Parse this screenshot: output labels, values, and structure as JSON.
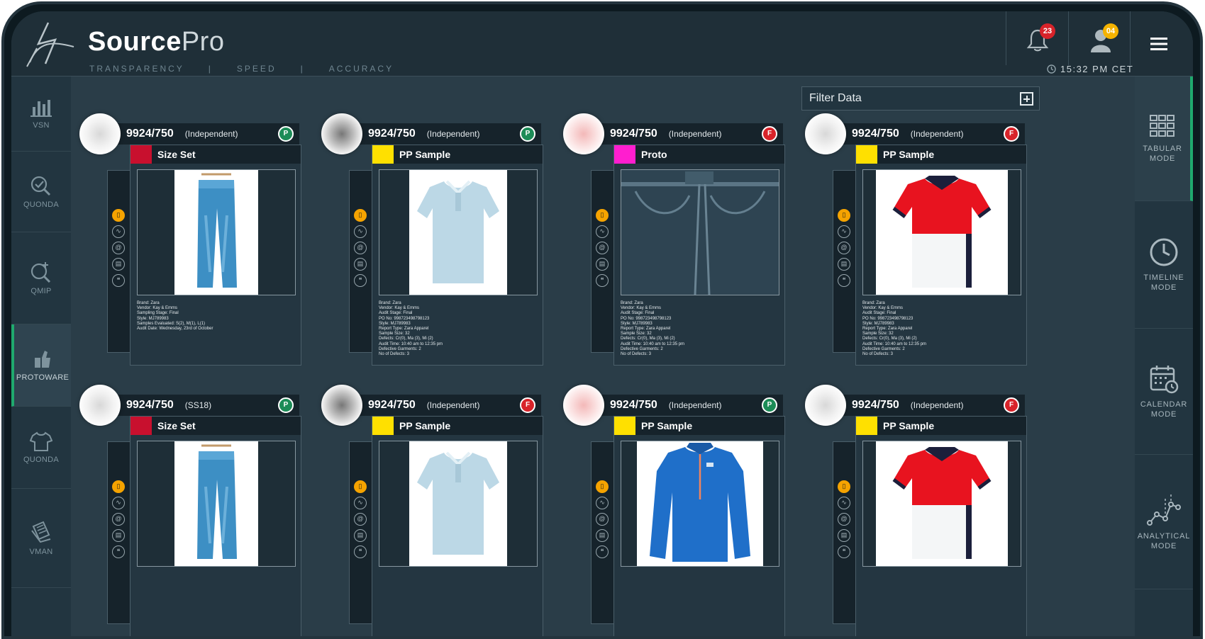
{
  "header": {
    "brand_bold": "Source",
    "brand_light": "Pro",
    "tag1": "TRANSPARENCY",
    "tag2": "SPEED",
    "tag3": "ACCURACY",
    "tag_sep": "|",
    "notifications_count": "23",
    "user_count": "04",
    "time": "15:32 PM CET"
  },
  "left_nav": [
    {
      "label": "VSN",
      "icon": "bar-chart-icon"
    },
    {
      "label": "QUONDA",
      "icon": "search-check-icon"
    },
    {
      "label": "QMIP",
      "icon": "search-plus-icon"
    },
    {
      "label": "PROTOWARE",
      "icon": "hand-icon"
    },
    {
      "label": "QUONDA",
      "icon": "tshirt-icon"
    },
    {
      "label": "VMAN",
      "icon": "document-icon"
    }
  ],
  "right_nav": [
    {
      "line1": "TABULAR",
      "line2": "MODE",
      "icon": "grid-icon"
    },
    {
      "line1": "TIMELINE",
      "line2": "MODE",
      "icon": "clock-icon"
    },
    {
      "line1": "CALENDAR",
      "line2": "MODE",
      "icon": "calendar-icon"
    },
    {
      "line1": "ANALYTICAL",
      "line2": "MODE",
      "icon": "graph-icon"
    }
  ],
  "filter": {
    "label": "Filter Data"
  },
  "colors": {
    "pass": "#1c8c57",
    "fail": "#d8232a",
    "red": "#c8102e",
    "yellow": "#ffe000",
    "magenta": "#ff1ecf"
  },
  "cards": [
    {
      "code": "9924/750",
      "season": "(Independent)",
      "status": "P",
      "sample": "Size Set",
      "swatch": "#c8102e",
      "details": [
        "Brand: Zara",
        "Vendor: Kay & Emms",
        "Sampling Stage: Final",
        "Style: MJ789983",
        "Samples Evaluated: S(2), M(1), L(1)",
        "Audit Date: Wednesday, 23rd of October"
      ]
    },
    {
      "code": "9924/750",
      "season": "(Independent)",
      "status": "P",
      "sample": "PP Sample",
      "swatch": "#ffe000",
      "details": [
        "Brand: Zara",
        "Vendor: Kay & Emms",
        "Audit Stage: Final",
        "PO No: 998723498798123",
        "Style: MJ789983",
        "Report Type: Zara Apparel",
        "Sample Size: 32",
        "Defects: Cr(0), Ma (3), Mi (2)",
        "Audit Time: 10:40 am to 12:35 pm",
        "Defective Garments: 2",
        "No of Defects: 3"
      ]
    },
    {
      "code": "9924/750",
      "season": "(Independent)",
      "status": "F",
      "sample": "Proto",
      "swatch": "#ff1ecf",
      "details": [
        "Brand: Zara",
        "Vendor: Kay & Emms",
        "Audit Stage: Final",
        "PO No: 998723498798123",
        "Style: MJ789983",
        "Report Type: Zara Apparel",
        "Sample Size: 32",
        "Defects: Cr(0), Ma (3), Mi (2)",
        "Audit Time: 10:40 am to 12:35 pm",
        "Defective Garments: 2",
        "No of Defects: 3"
      ]
    },
    {
      "code": "9924/750",
      "season": "(Independent)",
      "status": "F",
      "sample": "PP Sample",
      "swatch": "#ffe000",
      "details": [
        "Brand: Zara",
        "Vendor: Kay & Emms",
        "Audit Stage: Final",
        "PO No: 998723498798123",
        "Style: MJ789983",
        "Report Type: Zara Apparel",
        "Sample Size: 32",
        "Defects: Cr(0), Ma (3), Mi (2)",
        "Audit Time: 10:40 am to 12:35 pm",
        "Defective Garments: 2",
        "No of Defects: 3"
      ]
    },
    {
      "code": "9924/750",
      "season": "(SS18)",
      "status": "P",
      "sample": "Size Set",
      "swatch": "#c8102e",
      "details": []
    },
    {
      "code": "9924/750",
      "season": "(Independent)",
      "status": "F",
      "sample": "PP Sample",
      "swatch": "#ffe000",
      "details": []
    },
    {
      "code": "9924/750",
      "season": "(Independent)",
      "status": "P",
      "sample": "PP Sample",
      "swatch": "#ffe000",
      "details": []
    },
    {
      "code": "9924/750",
      "season": "(Independent)",
      "status": "F",
      "sample": "PP Sample",
      "swatch": "#ffe000",
      "details": []
    }
  ]
}
